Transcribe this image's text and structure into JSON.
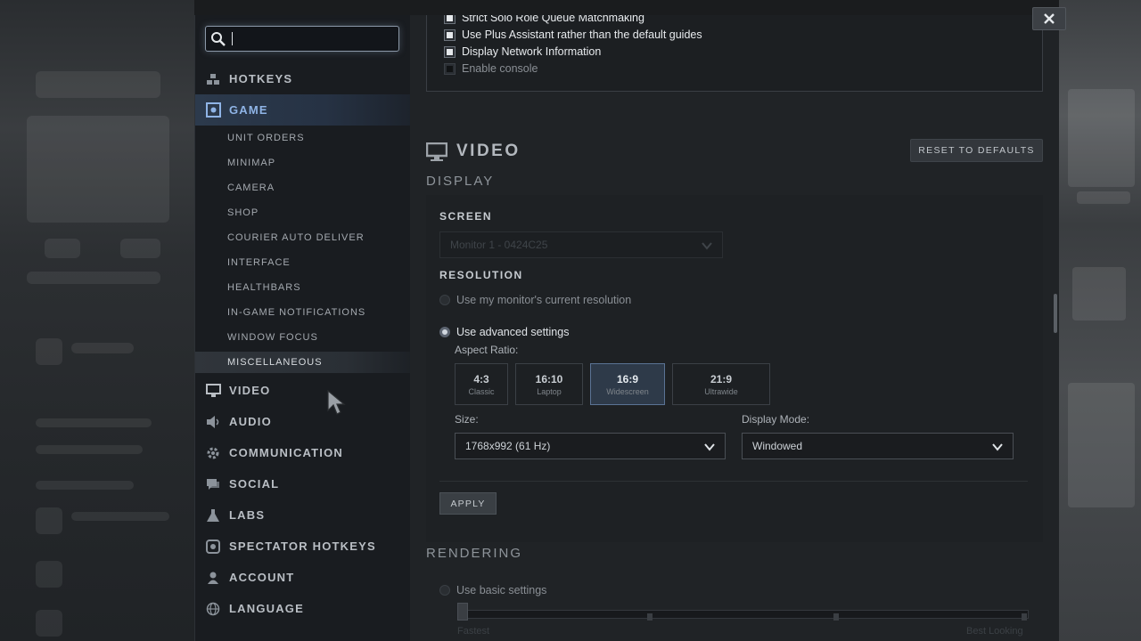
{
  "search": {
    "value": "",
    "placeholder": ""
  },
  "nav": {
    "top": [
      {
        "label": "HOTKEYS",
        "icon": "hotkeys-icon"
      },
      {
        "label": "GAME",
        "icon": "game-icon",
        "active": true
      }
    ],
    "game_sub": [
      "UNIT ORDERS",
      "MINIMAP",
      "CAMERA",
      "SHOP",
      "COURIER AUTO DELIVER",
      "INTERFACE",
      "HEALTHBARS",
      "IN-GAME NOTIFICATIONS",
      "WINDOW FOCUS",
      "MISCELLANEOUS"
    ],
    "bottom": [
      {
        "label": "VIDEO",
        "icon": "monitor-icon"
      },
      {
        "label": "AUDIO",
        "icon": "speaker-icon"
      },
      {
        "label": "COMMUNICATION",
        "icon": "gear-icon"
      },
      {
        "label": "SOCIAL",
        "icon": "chat-icon"
      },
      {
        "label": "LABS",
        "icon": "flask-icon"
      },
      {
        "label": "SPECTATOR HOTKEYS",
        "icon": "eye-icon"
      },
      {
        "label": "ACCOUNT",
        "icon": "user-icon"
      },
      {
        "label": "LANGUAGE",
        "icon": "globe-icon"
      }
    ]
  },
  "game_options": [
    {
      "label": "Strict Solo Role Queue Matchmaking",
      "checked": true
    },
    {
      "label": "Use Plus Assistant rather than the default guides",
      "checked": true
    },
    {
      "label": "Display Network Information",
      "checked": true
    },
    {
      "label": "Enable console",
      "checked": false
    }
  ],
  "video": {
    "title": "VIDEO",
    "reset_label": "RESET TO DEFAULTS",
    "display_title": "DISPLAY",
    "screen_label": "SCREEN",
    "screen_value": "Monitor 1 - 0424C25",
    "resolution_label": "RESOLUTION",
    "radio_current": "Use my monitor's current resolution",
    "radio_advanced": "Use advanced settings",
    "aspect_label": "Aspect Ratio:",
    "aspects": [
      {
        "ratio": "4:3",
        "name": "Classic"
      },
      {
        "ratio": "16:10",
        "name": "Laptop"
      },
      {
        "ratio": "16:9",
        "name": "Widescreen",
        "selected": true
      },
      {
        "ratio": "21:9",
        "name": "Ultrawide"
      }
    ],
    "size_label": "Size:",
    "size_value": "1768x992 (61 Hz)",
    "display_mode_label": "Display Mode:",
    "display_mode_value": "Windowed",
    "apply_label": "APPLY",
    "rendering_title": "RENDERING",
    "radio_basic": "Use basic settings",
    "slider_left": "Fastest",
    "slider_right": "Best Looking"
  },
  "colors": {
    "accent": "#8fb4e6",
    "active_bg": "#2c3a4c"
  }
}
